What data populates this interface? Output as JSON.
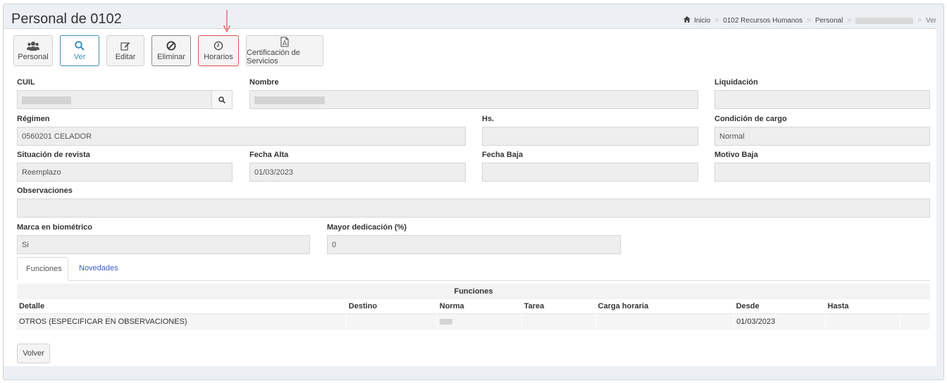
{
  "page": {
    "title": "Personal de 0102"
  },
  "breadcrumb": {
    "items": [
      "Inicio",
      "0102 Recursos Humanos",
      "Personal"
    ],
    "current": "Ver"
  },
  "toolbar": {
    "personal": "Personal",
    "ver": "Ver",
    "editar": "Editar",
    "eliminar": "Eliminar",
    "horarios": "Horarios",
    "certificacion": "Certificación de Servicios"
  },
  "form": {
    "cuil": {
      "label": "CUIL",
      "value": ""
    },
    "nombre": {
      "label": "Nombre",
      "value": ""
    },
    "liquidacion": {
      "label": "Liquidación",
      "value": ""
    },
    "regimen": {
      "label": "Régimen",
      "value": "0560201 CELADOR"
    },
    "hs": {
      "label": "Hs.",
      "value": ""
    },
    "condicion": {
      "label": "Condición de cargo",
      "value": "Normal"
    },
    "situacion": {
      "label": "Situación de revista",
      "value": "Reemplazo"
    },
    "fecha_alta": {
      "label": "Fecha Alta",
      "value": "01/03/2023"
    },
    "fecha_baja": {
      "label": "Fecha Baja",
      "value": ""
    },
    "motivo_baja": {
      "label": "Motivo Baja",
      "value": ""
    },
    "observaciones": {
      "label": "Observaciones",
      "value": ""
    },
    "marca": {
      "label": "Marca en biométrico",
      "value": "Si"
    },
    "dedicacion": {
      "label": "Mayor dedicación (%)",
      "value": "0"
    }
  },
  "tabs": {
    "funciones": "Funciones",
    "novedades": "Novedades"
  },
  "table": {
    "caption": "Funciones",
    "headers": {
      "detalle": "Detalle",
      "destino": "Destino",
      "norma": "Norma",
      "tarea": "Tarea",
      "carga": "Carga horaria",
      "desde": "Desde",
      "hasta": "Hasta"
    },
    "rows": [
      {
        "detalle": "OTROS (ESPECIFICAR EN OBSERVACIONES)",
        "destino": "",
        "norma": "",
        "tarea": "",
        "carga": "",
        "desde": "01/03/2023",
        "hasta": ""
      }
    ]
  },
  "footer": {
    "volver": "Volver"
  },
  "colors": {
    "accent": "#3c8dbc",
    "danger": "#d9534f",
    "link": "#3c5bc0"
  }
}
